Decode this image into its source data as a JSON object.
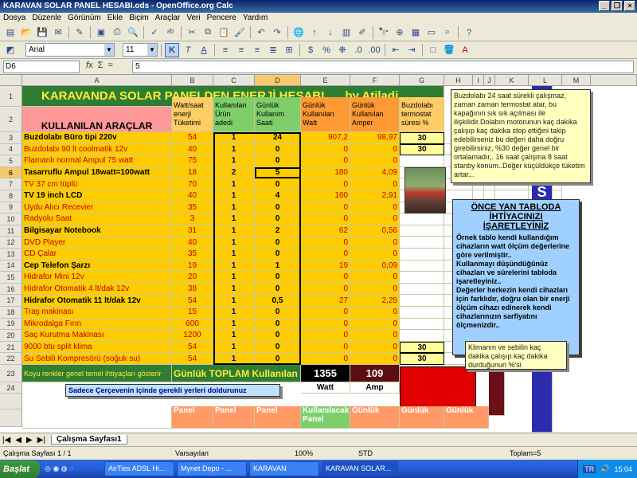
{
  "window": {
    "title": "KARAVAN SOLAR PANEL HESABI.ods - OpenOffice.org Calc"
  },
  "menu": [
    "Dosya",
    "Düzenle",
    "Görünüm",
    "Ekle",
    "Biçim",
    "Araçlar",
    "Veri",
    "Pencere",
    "Yardım"
  ],
  "format": {
    "font": "Arial",
    "size": "11"
  },
  "formula": {
    "cellref": "D6",
    "value": "5"
  },
  "columns": [
    "A",
    "B",
    "C",
    "D",
    "E",
    "F",
    "G",
    "H",
    "I",
    "J",
    "K",
    "L",
    "M"
  ],
  "sheet": {
    "title": "KARAVANDA SOLAR PANELDEN  ENERJİ HESABI",
    "author": "by Atiladi",
    "hdr_a": "KULLANILAN ARAÇLAR",
    "hdr_b": [
      "Watt/saat",
      "enerji",
      "Tüketimi"
    ],
    "hdr_c": [
      "Kullanılan",
      "Ürün",
      "adedi"
    ],
    "hdr_d": [
      "Günlük",
      "Kullanım",
      "Saati"
    ],
    "hdr_e": [
      "Günlük",
      "Kullanılan",
      "Watt"
    ],
    "hdr_f": [
      "Günlük",
      "Kullanılan",
      "Amper"
    ],
    "hdr_g": [
      "Buzdolabı",
      "termostat",
      "süresi %"
    ],
    "rows": [
      {
        "n": "3",
        "name": "Buzdolabı Büro tipi 220v",
        "w": "54",
        "qty": "1",
        "hrs": "24",
        "watt": "907,2",
        "amp": "98,97",
        "pct": "30",
        "bold": true
      },
      {
        "n": "4",
        "name": "Buzdolabı 90 lt coolmatik 12v",
        "w": "40",
        "qty": "1",
        "hrs": "0",
        "watt": "0",
        "amp": "0",
        "pct": "30",
        "bold": false
      },
      {
        "n": "5",
        "name": "Flamanlı normal Ampul 75 watt",
        "w": "75",
        "qty": "1",
        "hrs": "0",
        "watt": "0",
        "amp": "0",
        "pct": "",
        "bold": false
      },
      {
        "n": "6",
        "name": "Tasarruflu Ampul  18watt=100watt",
        "w": "18",
        "qty": "2",
        "hrs": "5",
        "watt": "180",
        "amp": "4,09",
        "pct": "",
        "bold": true
      },
      {
        "n": "7",
        "name": "TV 37 cm tüplü",
        "w": "70",
        "qty": "1",
        "hrs": "0",
        "watt": "0",
        "amp": "0",
        "pct": "",
        "bold": false
      },
      {
        "n": "8",
        "name": "TV 19 inch LCD",
        "w": "40",
        "qty": "1",
        "hrs": "4",
        "watt": "160",
        "amp": "2,91",
        "pct": "",
        "bold": true
      },
      {
        "n": "9",
        "name": "Uydu Alıcı Recevier",
        "w": "35",
        "qty": "1",
        "hrs": "0",
        "watt": "0",
        "amp": "0",
        "pct": "",
        "bold": false
      },
      {
        "n": "10",
        "name": "Radyolu Saat",
        "w": "3",
        "qty": "1",
        "hrs": "0",
        "watt": "0",
        "amp": "0",
        "pct": "",
        "bold": false
      },
      {
        "n": "11",
        "name": "Bilgisayar Notebook",
        "w": "31",
        "qty": "1",
        "hrs": "2",
        "watt": "62",
        "amp": "0,56",
        "pct": "",
        "bold": true
      },
      {
        "n": "12",
        "name": "DVD Player",
        "w": "40",
        "qty": "1",
        "hrs": "0",
        "watt": "0",
        "amp": "0",
        "pct": "",
        "bold": false
      },
      {
        "n": "13",
        "name": "CD Çalar",
        "w": "35",
        "qty": "1",
        "hrs": "0",
        "watt": "0",
        "amp": "0",
        "pct": "",
        "bold": false
      },
      {
        "n": "14",
        "name": "Cep Telefon Şarzı",
        "w": "19",
        "qty": "1",
        "hrs": "1",
        "watt": "19",
        "amp": "0,09",
        "pct": "",
        "bold": true
      },
      {
        "n": "15",
        "name": "Hidrafor Mini 12v",
        "w": "20",
        "qty": "1",
        "hrs": "0",
        "watt": "0",
        "amp": "0",
        "pct": "",
        "bold": false
      },
      {
        "n": "16",
        "name": "Hidrafor Otomatik  4 lt/dak 12v",
        "w": "38",
        "qty": "1",
        "hrs": "0",
        "watt": "0",
        "amp": "0",
        "pct": "",
        "bold": false
      },
      {
        "n": "17",
        "name": "Hidrafor Otomatik 11 lt/dak 12v",
        "w": "54",
        "qty": "1",
        "hrs": "0,5",
        "watt": "27",
        "amp": "2,25",
        "pct": "",
        "bold": true
      },
      {
        "n": "18",
        "name": "Traş makinası",
        "w": "15",
        "qty": "1",
        "hrs": "0",
        "watt": "0",
        "amp": "0",
        "pct": "",
        "bold": false
      },
      {
        "n": "19",
        "name": "Mikrodalga Fırın",
        "w": "600",
        "qty": "1",
        "hrs": "0",
        "watt": "0",
        "amp": "0",
        "pct": "",
        "bold": false
      },
      {
        "n": "20",
        "name": "Saç Kurutma Makinası",
        "w": "1200",
        "qty": "1",
        "hrs": "0",
        "watt": "0",
        "amp": "0",
        "pct": "",
        "bold": false
      },
      {
        "n": "21",
        "name": "9000 btu split klima",
        "w": "54",
        "qty": "1",
        "hrs": "0",
        "watt": "0",
        "amp": "0",
        "pct": "30",
        "bold": false
      },
      {
        "n": "22",
        "name": "Su Sebili Kompresörü (soğuk su)",
        "w": "54",
        "qty": "1",
        "hrs": "0",
        "watt": "0",
        "amp": "0",
        "pct": "30",
        "bold": false
      }
    ],
    "footer_note": "Koyu renkler genel temel ihtiyaçları gösterir",
    "total_label": "Günlük TOPLAM Kullanılan",
    "total_watt": "1355",
    "total_amp": "109",
    "watt_unit": "Watt",
    "amp_unit": "Amp",
    "fill_note": "Sadece Çerçevenin içinde gerekli yerleri doldurunuz",
    "bottom_hdrs": [
      "Panel",
      "Panel",
      "Panel",
      "Kullanılacak",
      "Günlük",
      "Günlük",
      "Günlük"
    ],
    "bottom_hdr2": [
      "",
      "",
      "",
      "Panel",
      "",
      "",
      ""
    ]
  },
  "notes": {
    "fridge": "Buzdolabı 24 saat sürekli çalışmaz, zaman zaman termostat atar, bu kapağının sık sık açılması ile ilişkilidir.Dolabın motorunun kaç dakika çalışıp kaç dakika stop ettiğini takip edebilirseniz bu değeri daha doğru girebilirsiniz, %30 değer genel bir ortalamadır,. 16 saat çalışma 8 saat stanby konum..Değer küçüldükçe tüketim artar...",
    "blue_title": "ÖNCE YAN TABLODA İHTİYACINIZI İŞARETLEYİNİZ",
    "blue_body": "Örnek tablo kendi kullandığım cihazların watt ölçüm değerlerine göre verilmiştir..\nKullanmayı düşündüğünüz cihazları ve sürelerini tabloda işaretleyiniz..\nDeğerler herkezin kendi cihazları için farklıdır, doğru olan bir enerji ölçüm cihazı edinerek kendi cihazlarınızın sarfiyatını ölçmenizdir..",
    "klima": "Klimanın ve sebilin kaç dakika çalışıp kaç dakika durduğunun %'si",
    "side": [
      "1",
      "S",
      "A",
      "Y",
      "F",
      "A",
      "1"
    ]
  },
  "tabs": {
    "active": "Çalışma Sayfası1"
  },
  "status": {
    "sheet": "Çalışma Sayfası 1 / 1",
    "style": "Varsayılan",
    "zoom": "100%",
    "mode": "STD",
    "sum": "Toplam=5"
  },
  "taskbar": {
    "start": "Başlat",
    "tasks": [
      "AirTies ADSL Hi...",
      "Mynet Depo - ...",
      "KARAVAN",
      "KARAVAN SOLAR..."
    ],
    "lang": "TR",
    "time": "15:04"
  },
  "colors": {
    "title_bg": "#2e7d32",
    "title_fg": "#ffeb3b",
    "row_bg": "#ffcc00",
    "header_bg": "#ff9966",
    "green_hdr": "#7ecf6a",
    "side_bar": "#2b2bb0"
  }
}
